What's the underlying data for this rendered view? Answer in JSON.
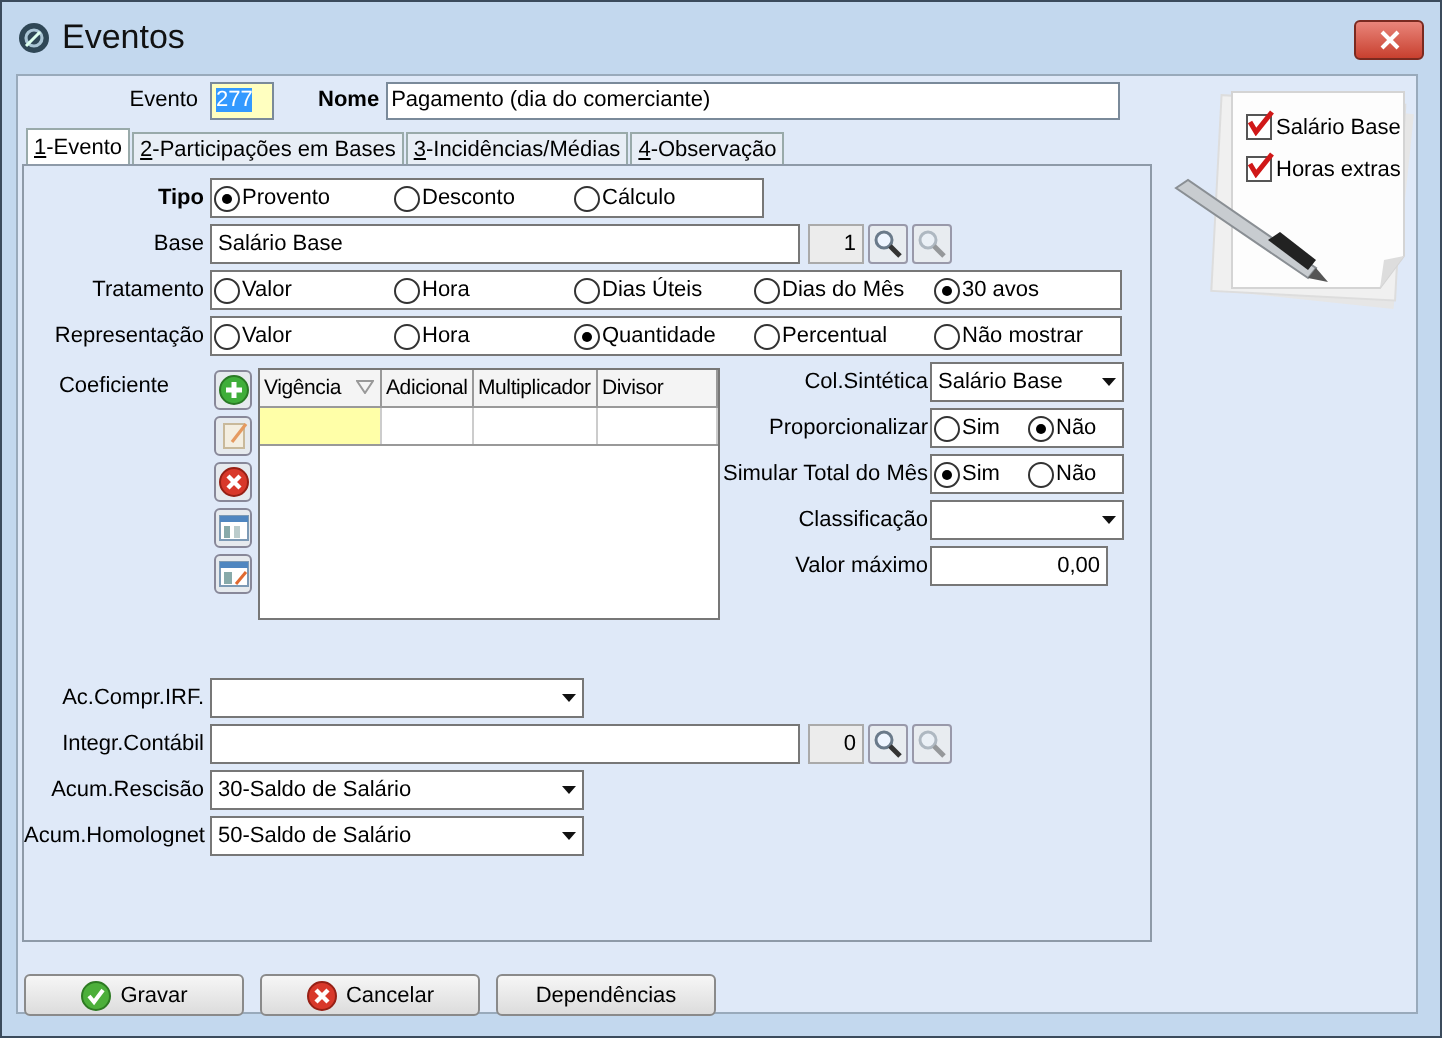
{
  "window": {
    "title": "Eventos"
  },
  "header": {
    "evento": {
      "label": "Evento",
      "value": "277",
      "selected": true
    },
    "nome": {
      "label": "Nome",
      "value": "Pagamento (dia do comerciante)"
    }
  },
  "tabs": [
    {
      "label": "1-Evento",
      "selected": true
    },
    {
      "label": "2-Participações em Bases",
      "selected": false
    },
    {
      "label": "3-Incidências/Médias",
      "selected": false
    },
    {
      "label": "4-Observação",
      "selected": false
    }
  ],
  "top_fields": [
    {
      "kind": "radio",
      "label": "Tipo",
      "bold": true,
      "options": [
        {
          "label": "Provento",
          "selected": true
        },
        {
          "label": "Desconto",
          "selected": false
        },
        {
          "label": "Cálculo",
          "selected": false
        }
      ]
    },
    {
      "kind": "lookup",
      "label": "Base",
      "value": "Salário Base",
      "code": "1"
    },
    {
      "kind": "radio",
      "label": "Tratamento",
      "options": [
        {
          "label": "Valor",
          "selected": false
        },
        {
          "label": "Hora",
          "selected": false
        },
        {
          "label": "Dias Úteis",
          "selected": false
        },
        {
          "label": "Dias do Mês",
          "selected": false
        },
        {
          "label": "30 avos",
          "selected": true
        }
      ]
    },
    {
      "kind": "radio",
      "label": "Representação",
      "options": [
        {
          "label": "Valor",
          "selected": false
        },
        {
          "label": "Hora",
          "selected": false
        },
        {
          "label": "Quantidade",
          "selected": true
        },
        {
          "label": "Percentual",
          "selected": false
        },
        {
          "label": "Não mostrar",
          "selected": false
        }
      ]
    }
  ],
  "coeficiente": {
    "label": "Coeficiente",
    "columns": [
      {
        "label": "Vigência",
        "sorted": true
      },
      {
        "label": "Adicional",
        "sorted": false
      },
      {
        "label": "Multiplicador",
        "sorted": false
      },
      {
        "label": "Divisor",
        "sorted": false
      }
    ],
    "new_row": [
      {
        "selected": true
      },
      {
        "selected": false
      },
      {
        "selected": false
      },
      {
        "selected": false
      }
    ]
  },
  "right_fields": [
    {
      "kind": "combo",
      "label": "Col.Sintética",
      "value": "Salário Base"
    },
    {
      "kind": "radio",
      "label": "Proporcionalizar",
      "options": [
        {
          "label": "Sim",
          "selected": false
        },
        {
          "label": "Não",
          "selected": true
        }
      ]
    },
    {
      "kind": "radio",
      "label": "Simular Total do Mês",
      "options": [
        {
          "label": "Sim",
          "selected": true
        },
        {
          "label": "Não",
          "selected": false
        }
      ]
    },
    {
      "kind": "combo",
      "label": "Classificação"
    },
    {
      "kind": "number",
      "label": "Valor máximo",
      "value": "0,00"
    }
  ],
  "lower_fields": [
    {
      "kind": "combo",
      "label": "Ac.Compr.IRF."
    },
    {
      "kind": "lookup",
      "label": "Integr.Contábil",
      "code": "0"
    },
    {
      "kind": "combo",
      "label": "Acum.Rescisão",
      "value": "30-Saldo de Salário"
    },
    {
      "kind": "combo",
      "label": "Acum.Homolognet",
      "value": "50-Saldo de Salário"
    }
  ],
  "checklist": [
    {
      "label": "Salário Base",
      "checked": true
    },
    {
      "label": "Horas extras",
      "checked": true
    }
  ],
  "buttons": [
    {
      "kind": "save",
      "label": "Gravar"
    },
    {
      "kind": "cancel",
      "label": "Cancelar"
    },
    {
      "kind": "plain",
      "label": "Dependências"
    }
  ]
}
